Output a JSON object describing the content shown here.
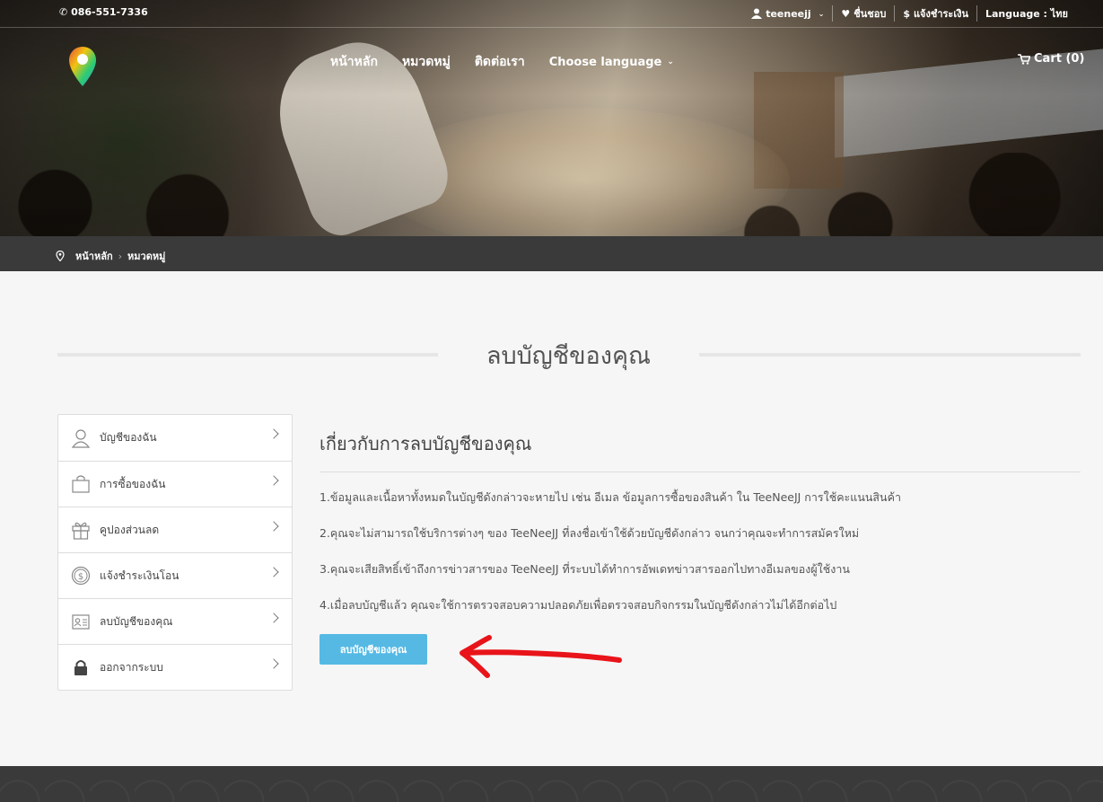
{
  "topbar": {
    "phone": "086-551-7336",
    "username": "teeneejj",
    "favorites": "ชื่นชอบ",
    "payment": "แจ้งชำระเงิน",
    "language": "Language : ไทย"
  },
  "nav": {
    "items": [
      "หน้าหลัก",
      "หมวดหมู่",
      "ติดต่อเรา"
    ],
    "choose_language": "Choose language",
    "cart": "Cart (0)"
  },
  "breadcrumb": {
    "home": "หน้าหลัก",
    "category": "หมวดหมู่"
  },
  "page_title": "ลบบัญชีของคุณ",
  "sidebar": {
    "items": [
      {
        "label": "บัญชีของฉัน",
        "icon": "user-icon"
      },
      {
        "label": "การซื้อของฉัน",
        "icon": "shopping-bag-icon"
      },
      {
        "label": "คูปองส่วนลด",
        "icon": "gift-icon"
      },
      {
        "label": "แจ้งชำระเงินโอน",
        "icon": "coin-icon"
      },
      {
        "label": "ลบบัญชีของคุณ",
        "icon": "id-card-icon"
      },
      {
        "label": "ออกจากระบบ",
        "icon": "lock-icon"
      }
    ]
  },
  "content": {
    "heading": "เกี่ยวกับการลบบัญชีของคุณ",
    "paragraphs": [
      "1.ข้อมูลและเนื้อหาทั้งหมดในบัญชีดังกล่าวจะหายไป เช่น อีเมล ข้อมูลการซื้อของสินค้า ใน TeeNeeJJ การใช้คะแนนสินค้า",
      "2.คุณจะไม่สามารถใช้บริการต่างๆ ของ TeeNeeJJ ที่ลงชื่อเข้าใช้ด้วยบัญชีดังกล่าว จนกว่าคุณจะทำการสมัครใหม่",
      "3.คุณจะเสียสิทธิ์เข้าถึงการข่าวสารของ TeeNeeJJ ที่ระบบได้ทำการอัพเดทข่าวสารออกไปทางอีเมลของผู้ใช้งาน",
      "4.เมื่อลบบัญชีแล้ว คุณจะใช้การตรวจสอบความปลอดภัยเพื่อตรวจสอบกิจกรรมในบัญชีดังกล่าวไม่ได้อีกต่อไป"
    ],
    "delete_button": "ลบบัญชีของคุณ"
  },
  "colors": {
    "accent": "#55b9e4",
    "dark_bar": "#3a3a3a",
    "annotation_arrow": "#e8141a"
  }
}
